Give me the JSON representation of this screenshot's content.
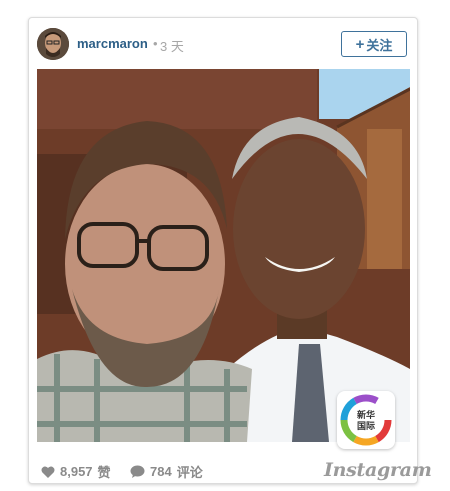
{
  "post": {
    "username": "marcmaron",
    "separator": "•",
    "time_ago": "3 天",
    "follow_label": "关注",
    "follow_plus": "+",
    "likes_count": "8,957",
    "likes_label": "赞",
    "comments_count": "784",
    "comments_label": "评论",
    "brand": "Instagram"
  },
  "watermark": {
    "line1": "新华",
    "line2": "国际"
  },
  "icons": {
    "like": "heart-icon",
    "comment": "comment-bubble-icon",
    "follow": "plus-icon"
  },
  "colors": {
    "username": "#2d5f87",
    "follow_border": "#3f729b",
    "muted_text": "#8a8a8a",
    "wood_wall": "#6f3f2c",
    "sky": "#aad4ee"
  }
}
